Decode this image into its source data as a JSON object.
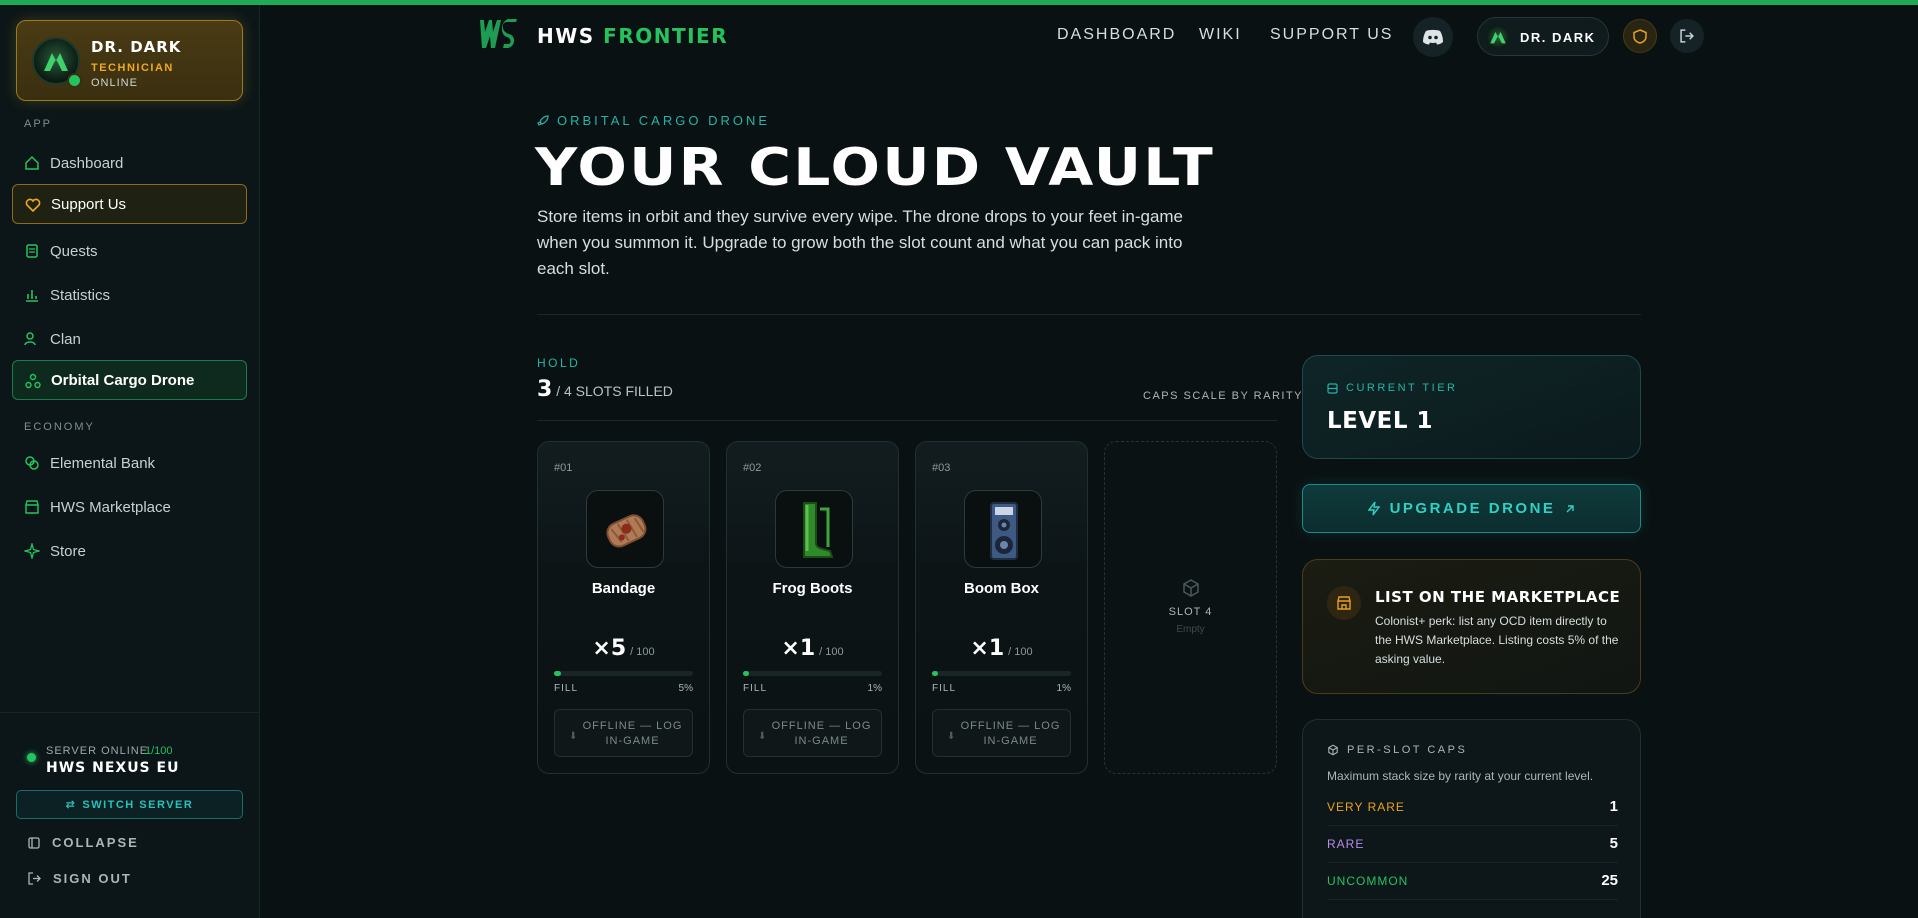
{
  "profile": {
    "name": "DR. DARK",
    "role": "TECHNICIAN",
    "status": "ONLINE"
  },
  "sidebar": {
    "app_label": "APP",
    "app_items": [
      {
        "label": "Dashboard",
        "icon": "home-icon"
      },
      {
        "label": "Support Us",
        "icon": "heart-icon"
      },
      {
        "label": "Quests",
        "icon": "scroll-icon"
      },
      {
        "label": "Statistics",
        "icon": "bar-chart-icon"
      },
      {
        "label": "Clan",
        "icon": "users-icon"
      },
      {
        "label": "Orbital Cargo Drone",
        "icon": "drone-icon"
      }
    ],
    "economy_label": "ECONOMY",
    "economy_items": [
      {
        "label": "Elemental Bank",
        "icon": "coins-icon"
      },
      {
        "label": "HWS Marketplace",
        "icon": "store-icon"
      },
      {
        "label": "Store",
        "icon": "sparkle-icon"
      }
    ],
    "server": {
      "label": "SERVER ONLINE",
      "count": "1/100",
      "name": "HWS NEXUS EU",
      "switch_label": "SWITCH SERVER"
    },
    "collapse_label": "COLLAPSE",
    "signout_label": "SIGN OUT"
  },
  "topnav": {
    "brand_a": "HWS",
    "brand_b": "FRONTIER",
    "links": [
      "DASHBOARD",
      "WIKI",
      "SUPPORT US"
    ],
    "user": "DR. DARK"
  },
  "hero": {
    "eyebrow": "ORBITAL CARGO DRONE",
    "title": "YOUR CLOUD VAULT",
    "description": "Store items in orbit and they survive every wipe. The drone drops to your feet in-game when you summon it. Upgrade to grow both the slot count and what you can pack into each slot."
  },
  "hold": {
    "label": "HOLD",
    "filled": "3",
    "total_text": "/ 4 SLOTS FILLED",
    "caps_note": "CAPS SCALE BY RARITY",
    "slots": [
      {
        "num": "#01",
        "name": "Bandage",
        "qty": "×5",
        "max": "/ 100",
        "fill_label": "FILL",
        "fill_pct": "5%",
        "fill": 0.05,
        "button": "OFFLINE — LOG IN-GAME"
      },
      {
        "num": "#02",
        "name": "Frog Boots",
        "qty": "×1",
        "max": "/ 100",
        "fill_label": "FILL",
        "fill_pct": "1%",
        "fill": 0.01,
        "button": "OFFLINE — LOG IN-GAME"
      },
      {
        "num": "#03",
        "name": "Boom Box",
        "qty": "×1",
        "max": "/ 100",
        "fill_label": "FILL",
        "fill_pct": "1%",
        "fill": 0.01,
        "button": "OFFLINE — LOG IN-GAME"
      }
    ],
    "empty_slot": {
      "title": "SLOT 4",
      "sub": "Empty"
    }
  },
  "tier": {
    "label": "CURRENT TIER",
    "value": "LEVEL 1"
  },
  "upgrade_label": "UPGRADE DRONE",
  "market": {
    "title": "LIST ON THE MARKETPLACE",
    "desc": "Colonist+ perk: list any OCD item directly to the HWS Marketplace. Listing costs 5% of the asking value."
  },
  "caps": {
    "label": "PER-SLOT CAPS",
    "desc": "Maximum stack size by rarity at your current level.",
    "rows": [
      {
        "name": "VERY RARE",
        "value": "1",
        "color": "#e8a21c"
      },
      {
        "name": "RARE",
        "value": "5",
        "color": "#b98be8"
      },
      {
        "name": "UNCOMMON",
        "value": "25",
        "color": "#23c45e"
      }
    ]
  },
  "colors": {
    "accent_green": "#23c45e",
    "accent_teal": "#23b5a8",
    "gold": "#e8a21c"
  }
}
